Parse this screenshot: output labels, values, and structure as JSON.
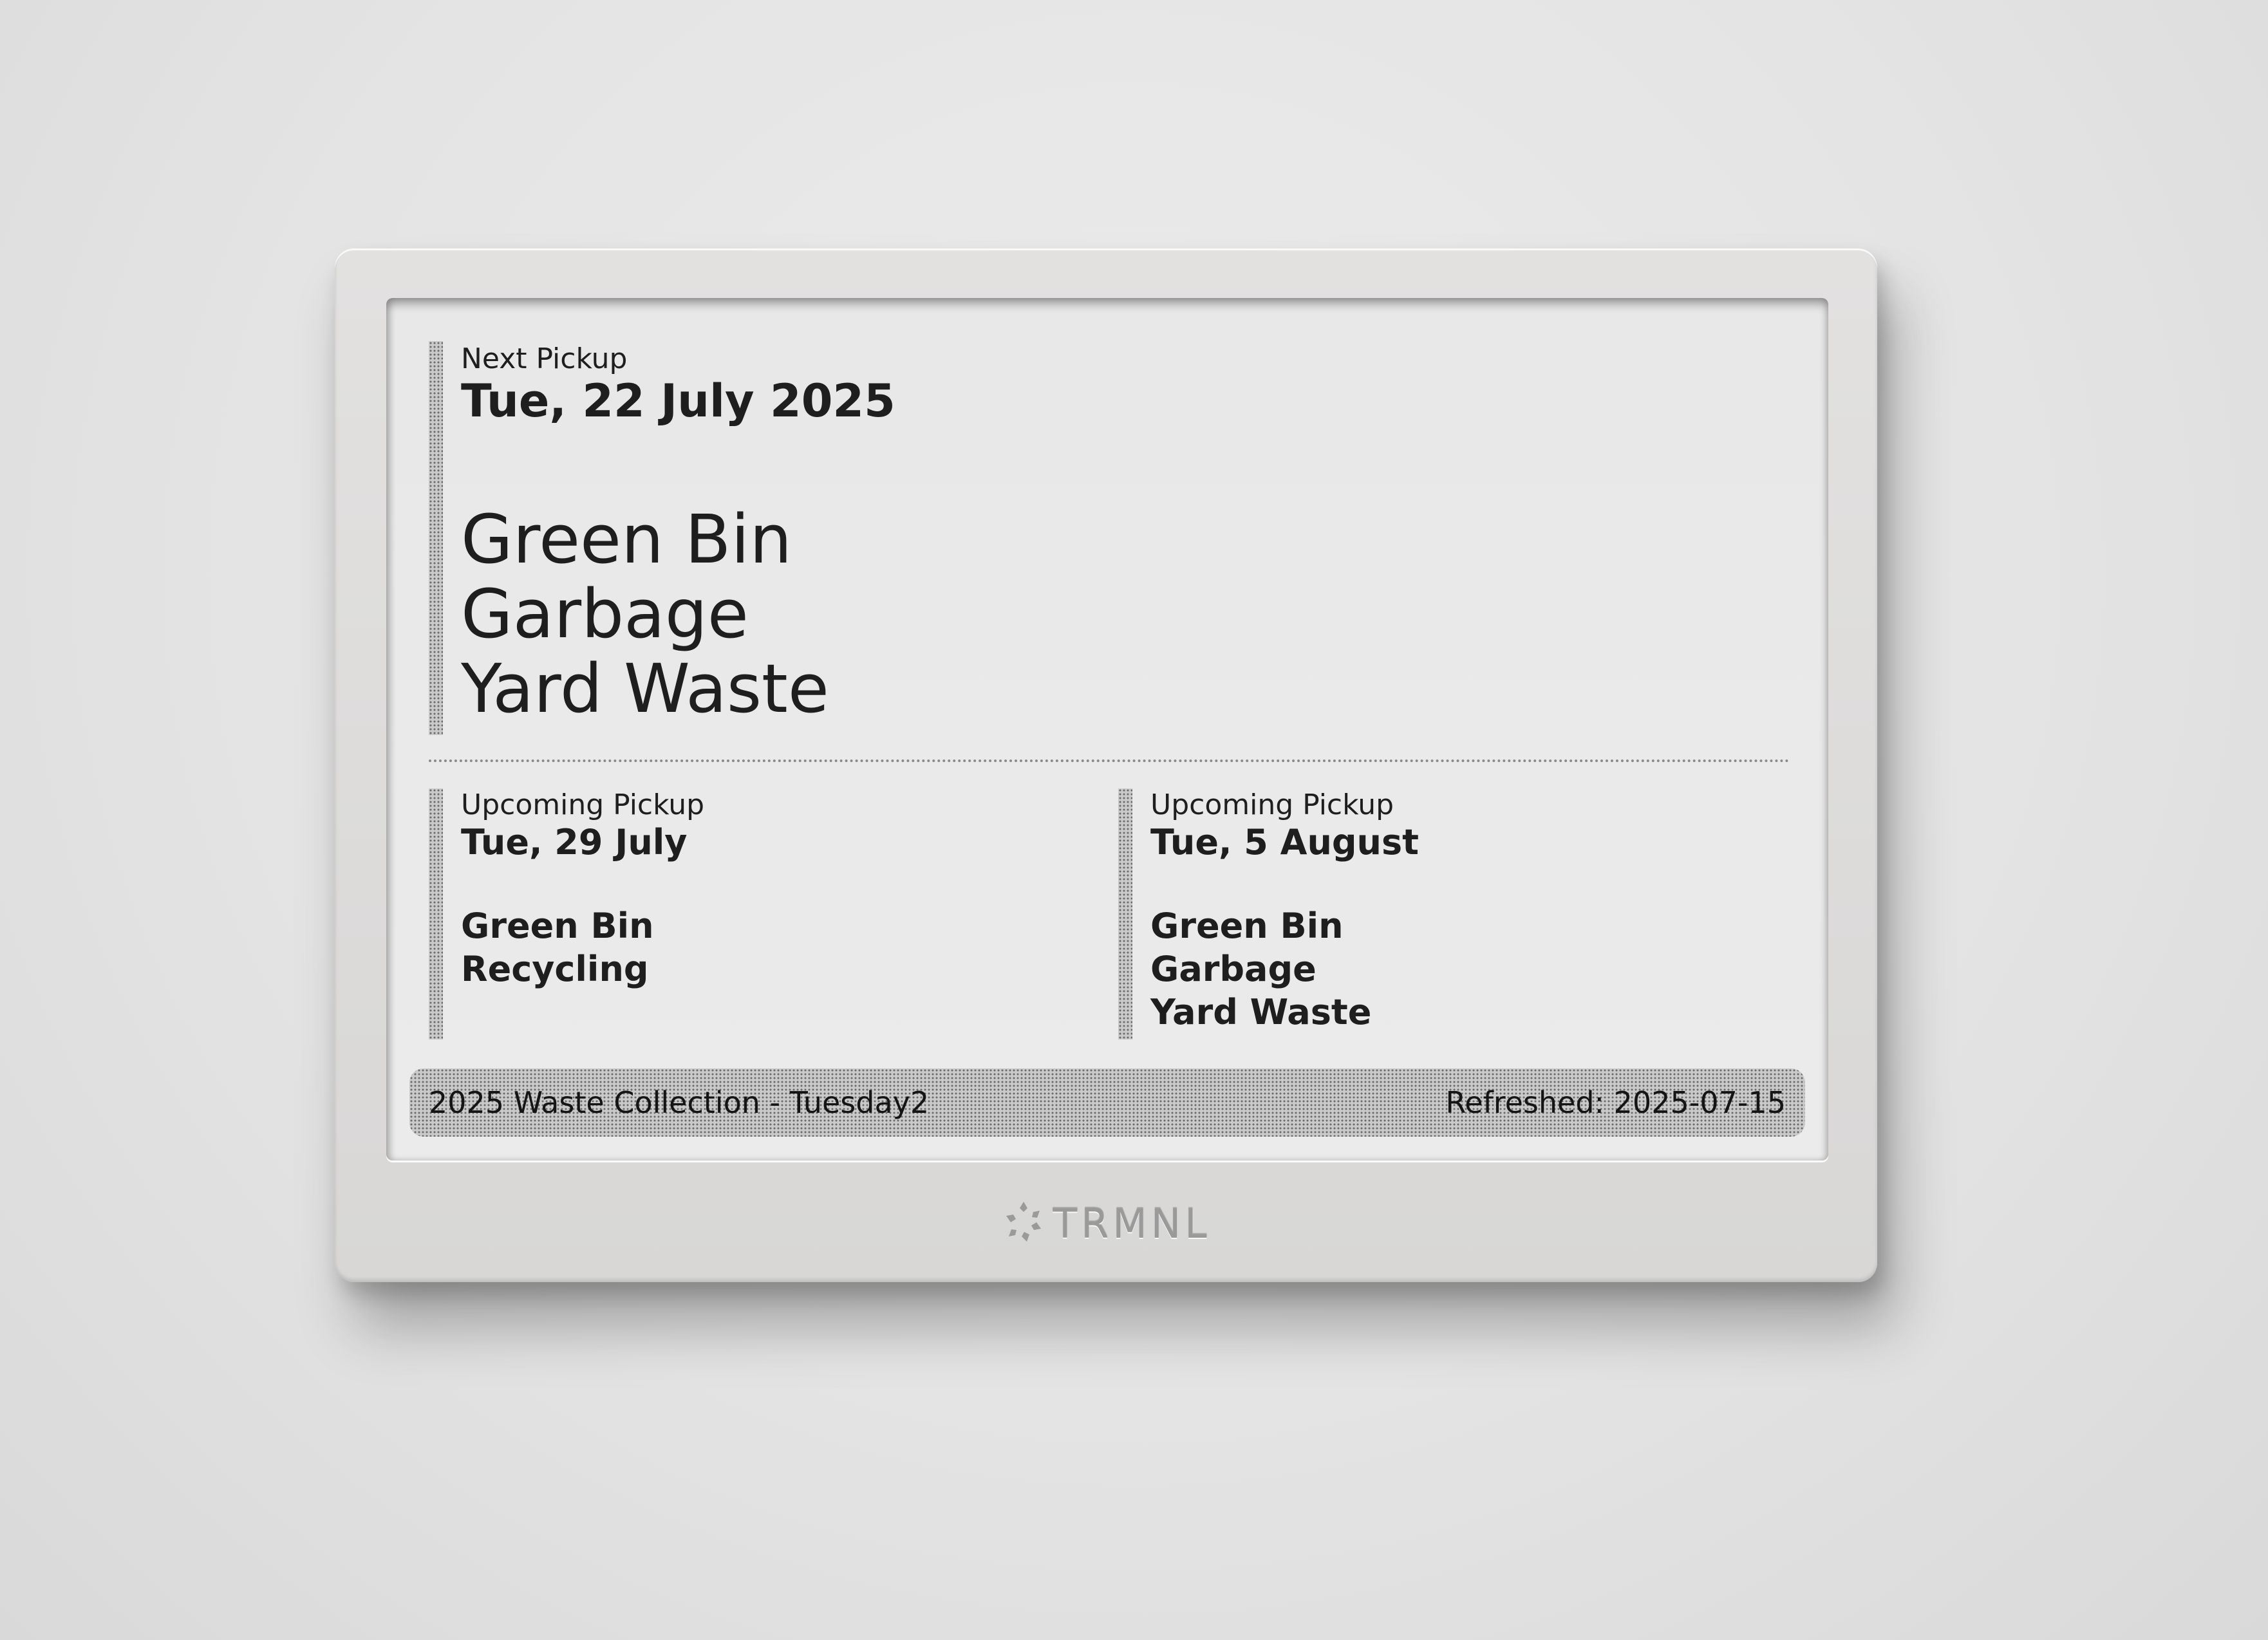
{
  "next": {
    "label": "Next Pickup",
    "date": "Tue, 22 July 2025",
    "items": [
      "Green Bin",
      "Garbage",
      "Yard Waste"
    ]
  },
  "upcoming": [
    {
      "label": "Upcoming Pickup",
      "date": "Tue, 29 July",
      "items": [
        "Green Bin",
        "Recycling"
      ]
    },
    {
      "label": "Upcoming Pickup",
      "date": "Tue, 5 August",
      "items": [
        "Green Bin",
        "Garbage",
        "Yard Waste"
      ]
    }
  ],
  "footer": {
    "title": "2025 Waste Collection - Tuesday2",
    "refreshed": "Refreshed: 2025-07-15"
  },
  "device": {
    "brand": "TRMNL",
    "logo_icon": "trmnl-logo-icon"
  }
}
